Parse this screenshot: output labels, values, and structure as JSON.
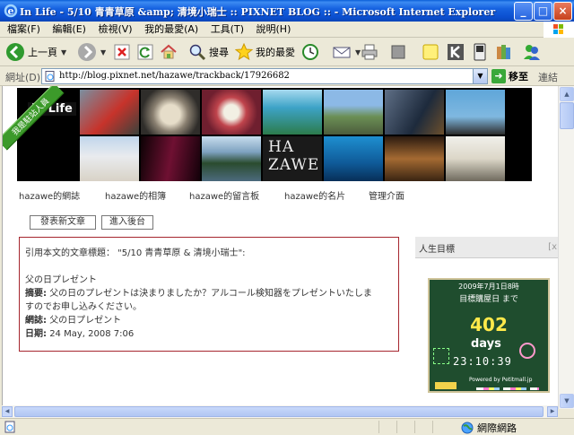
{
  "window": {
    "title": "In Life - 5/10 青青草原 &amp; 清境小瑞士 :: PIXNET BLOG :: - Microsoft Internet Explorer",
    "minimize": "_",
    "maximize": "□",
    "close": "×"
  },
  "menu": {
    "items": [
      "檔案(F)",
      "編輯(E)",
      "檢視(V)",
      "我的最愛(A)",
      "工具(T)",
      "說明(H)"
    ]
  },
  "toolbar": {
    "back_label": "上一頁",
    "search_label": "搜尋",
    "favorites_label": "我的最愛"
  },
  "address": {
    "label": "網址(D)",
    "url": "http://blog.pixnet.net/hazawe/trackback/17926682",
    "go_label": "移至",
    "links_label": "連結"
  },
  "blog": {
    "title": "In Life",
    "ribbon": "我是駐站人員",
    "banner_text": "HA ZAWE",
    "nav": [
      "hazawe的網誌",
      "hazawe的相簿",
      "hazawe的留言板",
      "hazawe的名片",
      "管理介面"
    ],
    "publish_button": "發表新文章",
    "backend_button": "進入後台"
  },
  "trackback": {
    "heading": "引用本文的文章標題： \"5/10 青青草原 & 清境小瑞士\":",
    "post_title": "父の日プレゼント",
    "summary_label": "摘要:",
    "summary_line1": "父の日のプレゼントは決まりましたか？アルコール検知器をプレゼントいたしま",
    "summary_line2": "すのでお申し込みください。",
    "site_label": "網誌:",
    "site_value": "父の日プレゼント",
    "date_label": "日期:",
    "date_value": "24 May, 2008 7:06"
  },
  "sidebar": {
    "title": "人生目標",
    "close": "[x"
  },
  "countdown": {
    "target": "2009年7月1日8時",
    "label": "目標購屋日 まで",
    "days_left": "402",
    "days_word": "days",
    "time": "23:10:39",
    "powered": "Powered by Petitmall.jp"
  },
  "status": {
    "zone": "網際網路"
  },
  "colors": {
    "titlebar": "#0a4fcf",
    "box_border": "#a6262e",
    "board": "#1f4d2e",
    "digits": "#ffe94a"
  }
}
